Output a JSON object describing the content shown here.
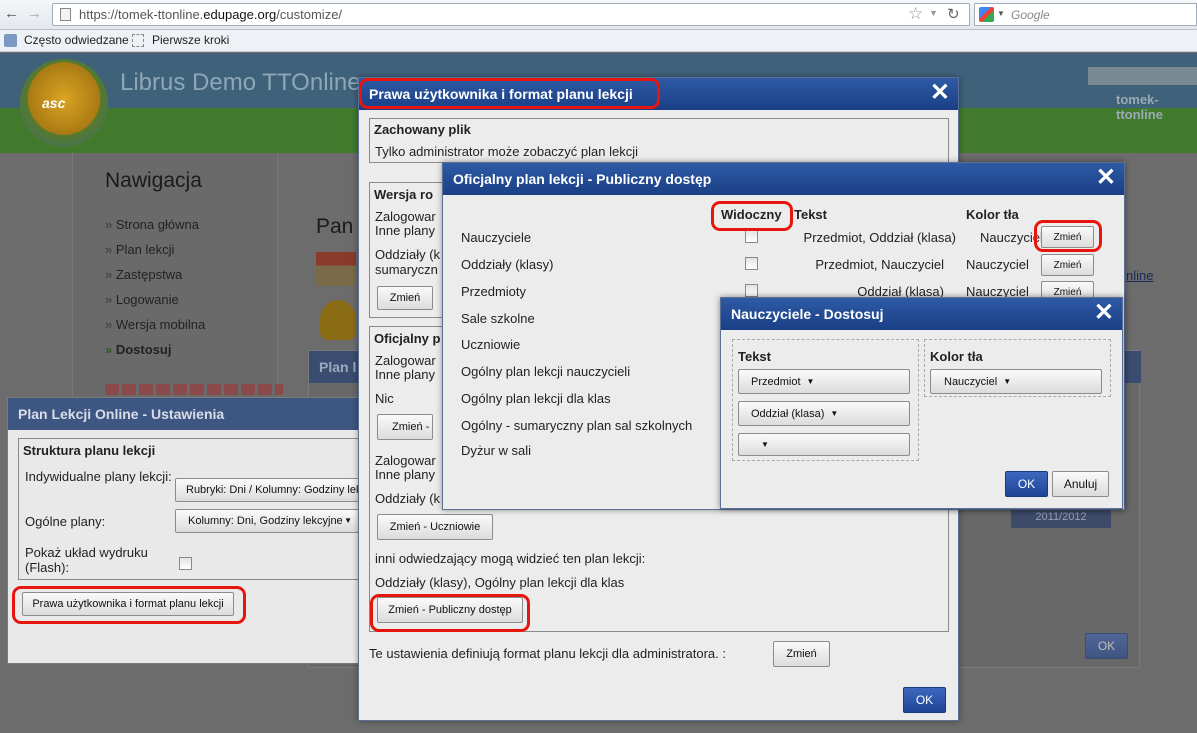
{
  "browser": {
    "url_prefix": "https://tomek-ttonline.",
    "url_domain": "edupage.org",
    "url_suffix": "/customize/",
    "search_placeholder": "Google",
    "bookmarks": [
      "Często odwiedzane",
      "Pierwsze kroki"
    ]
  },
  "site": {
    "title": "Librus Demo TTOnline",
    "user": "tomek-ttonline",
    "logo_text": "asc"
  },
  "nav": {
    "title": "Nawigacja",
    "items": [
      "Strona główna",
      "Plan lekcji",
      "Zastępstwa",
      "Logowanie",
      "Wersja mobilna",
      "Dostosuj"
    ]
  },
  "page": {
    "heading": "Pan",
    "link_fragment": "nline",
    "bg_dialog_title": "Plan l",
    "year": "2011/2012",
    "ok": "OK"
  },
  "settings_dialog": {
    "title": "Plan Lekcji Online - Ustawienia",
    "group_title": "Struktura planu lekcji",
    "individual_label": "Indywidualne plany lekcji:",
    "individual_value": "Rubryki: Dni / Kolumny: Godziny lek",
    "general_label": "Ogólne plany:",
    "general_value": "Kolumny: Dni, Godziny lekcyjne",
    "print_label": "Pokaż układ wydruku (Flash):",
    "rights_button": "Prawa użytkownika i format planu lekcji"
  },
  "rights_dialog": {
    "title": "Prawa użytkownika i format planu lekcji",
    "saved_title": "Zachowany plik",
    "saved_text": "Tylko administrator może zobaczyć plan lekcji",
    "version_title": "Wersja ro",
    "logged_a1": "Zalogowar",
    "logged_a2": "Inne plany",
    "classes_a1": "Oddziały (k",
    "classes_a2": "sumaryczn",
    "change": "Zmień",
    "official_title": "Oficjalny p",
    "logged_b1": "Zalogowar",
    "logged_b2": "Inne plany",
    "nic": "Nic",
    "change_teachers": "Zmień - Na",
    "logged_c1": "Zalogowar",
    "logged_c2": "Inne plany",
    "classes_c": "Oddziały (k",
    "change_students": "Zmień - Uczniowie",
    "others_text": "inni odwiedzający mogą widzieć ten plan lekcji:",
    "others_value": "Oddziały (klasy), Ogólny plan lekcji dla klas",
    "change_public": "Zmień - Publiczny dostęp",
    "footer_text": "Te ustawienia definiują format planu lekcji dla administratora. :",
    "footer_change": "Zmień",
    "ok": "OK"
  },
  "public_dialog": {
    "title": "Oficjalny plan lekcji - Publiczny dostęp",
    "col_visible": "Widoczny",
    "col_text": "Tekst",
    "col_bg": "Kolor tła",
    "rows": [
      {
        "label": "Nauczyciele",
        "text": "Przedmiot, Oddział (klasa)",
        "bg": "Nauczyciel",
        "btn": "Zmień"
      },
      {
        "label": "Oddziały (klasy)",
        "text": "Przedmiot, Nauczyciel",
        "bg": "Nauczyciel",
        "btn": "Zmień"
      },
      {
        "label": "Przedmioty",
        "text": "Oddział (klasa)",
        "bg": "Nauczyciel",
        "btn": "Zmień"
      },
      {
        "label": "Sale szkolne"
      },
      {
        "label": "Uczniowie"
      },
      {
        "label": "Ogólny plan lekcji nauczycieli"
      },
      {
        "label": "Ogólny plan lekcji dla klas"
      },
      {
        "label": "Ogólny - sumaryczny plan sal szkolnych"
      },
      {
        "label": "Dyżur w sali"
      }
    ]
  },
  "customize_dialog": {
    "title": "Nauczyciele - Dostosuj",
    "text_label": "Tekst",
    "bg_label": "Kolor tła",
    "dropdowns": [
      "Przedmiot",
      "Oddział (klasa)",
      ""
    ],
    "bg_dropdown": "Nauczyciel",
    "ok": "OK",
    "cancel": "Anuluj"
  },
  "colors": {
    "dialog_header": "#1e4591",
    "highlight": "#e8140e",
    "green_bar": "#5aaa3a"
  }
}
